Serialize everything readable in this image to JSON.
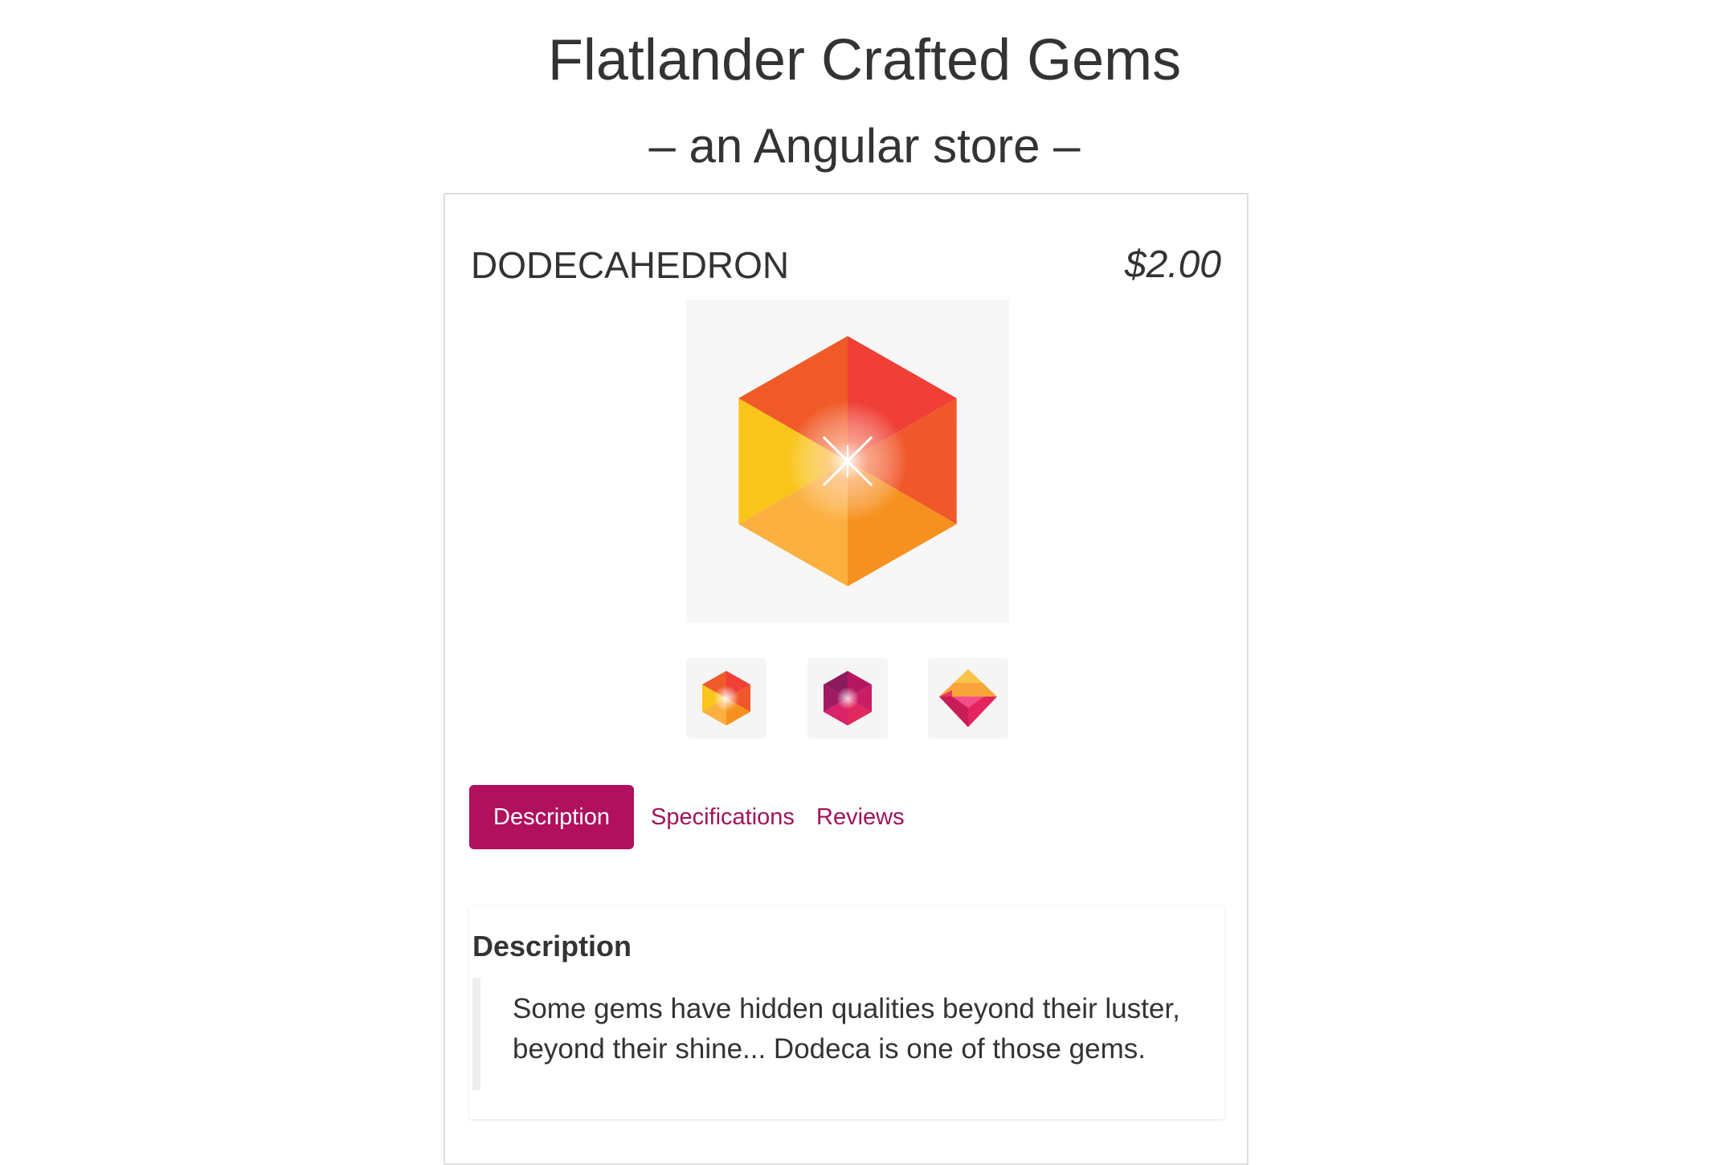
{
  "header": {
    "title": "Flatlander Crafted Gems",
    "subtitle": "– an Angular store –"
  },
  "product": {
    "name": "DODECAHEDRON",
    "price": "$2.00",
    "main_image": "orange-hexagon-gem",
    "thumbnails": [
      "orange-hexagon-gem",
      "magenta-hexagon-gem",
      "pink-diamond-gem"
    ]
  },
  "tabs": [
    {
      "label": "Description",
      "active": true
    },
    {
      "label": "Specifications",
      "active": false
    },
    {
      "label": "Reviews",
      "active": false
    }
  ],
  "description": {
    "heading": "Description",
    "text": "Some gems have hidden qualities beyond their luster, beyond their shine... Dodeca is one of those gems."
  },
  "colors": {
    "accent": "#b0105e",
    "tab_link": "#a0135b",
    "text": "#333333"
  }
}
